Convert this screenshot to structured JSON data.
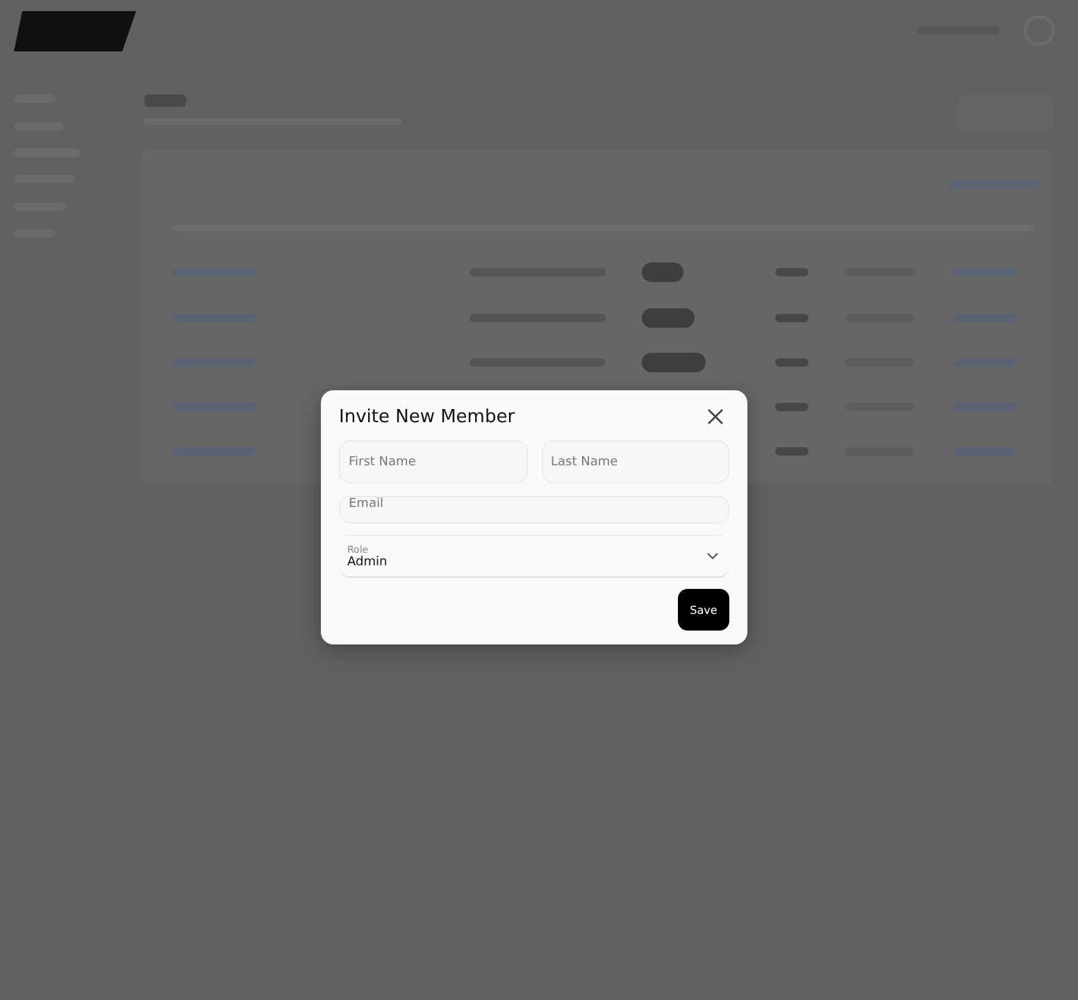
{
  "dialog": {
    "title": "Invite New Member",
    "name_fields": [
      {
        "placeholder": "First Name"
      },
      {
        "placeholder": "Last Name"
      }
    ],
    "email_field": {
      "placeholder": "Email"
    },
    "role_select": {
      "label": "Role",
      "value": "Admin"
    },
    "save_button": "Save"
  }
}
